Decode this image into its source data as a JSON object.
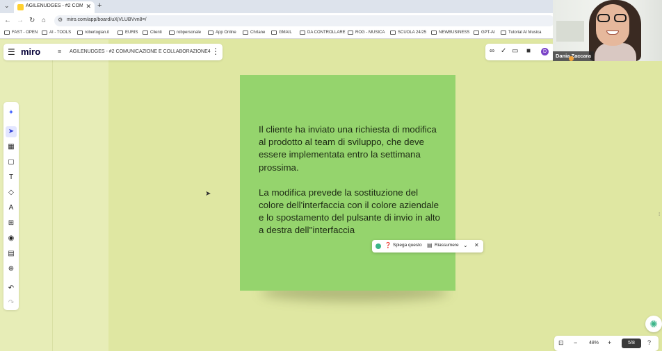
{
  "browser": {
    "tab_title": "AGILENUDGES - #2 COMUNIC...",
    "url": "miro.com/app/board/uXjVLUBVvn8=/",
    "bookmarks": [
      "FAST - OPEN",
      "AI - TOOLS",
      "robertogian.it",
      "EURIS",
      "Clienti",
      "robpersonale",
      "App Online",
      "Chrtane",
      "GMAIL",
      "DA CONTROLLARE",
      "ROG - MUSICA",
      "SCUOLA 24/25",
      "NEWBUSINESS",
      "GPT-AI",
      "Tutorial AI Musica"
    ]
  },
  "miro": {
    "logo": "miro",
    "board_title": "AGILENUDGES - #2 COMUNICAZIONE E COLLABORAZIONE4",
    "avatar_letter": "D"
  },
  "sticky": {
    "paragraph1": "Il cliente ha inviato una richiesta di modifica al prodotto al team di sviluppo, che deve essere implementata entro la settimana prossima.",
    "paragraph2": "La modifica prevede la sostituzione del colore dell'interfaccia con il colore aziendale e lo spostamento del pulsante di invio in alto a destra dell''interfaccia",
    "color": "#95d46d"
  },
  "ai_popup": {
    "explain_label": "Spiega questo",
    "summarize_label": "Riassumere"
  },
  "zoom": {
    "level": "48%",
    "pages": "5/8"
  },
  "webcam": {
    "name": "Dania Zaccara"
  }
}
